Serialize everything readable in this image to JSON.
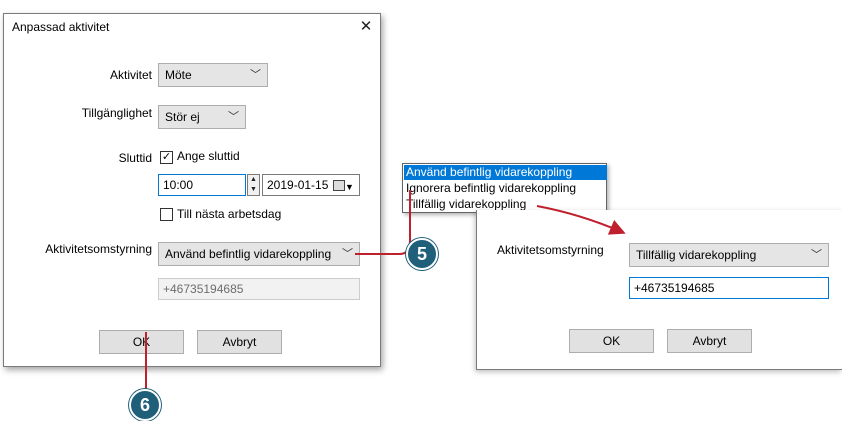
{
  "dialog": {
    "title": "Anpassad aktivitet",
    "close_glyph": "✕",
    "aktivitet": {
      "label": "Aktivitet",
      "value": "Möte"
    },
    "tillganglighet": {
      "label": "Tillgänglighet",
      "value": "Stör ej"
    },
    "sluttid": {
      "label": "Sluttid",
      "ange_label": "Ange sluttid",
      "ange_checked": true,
      "time": "10:00",
      "date": "2019-01-15"
    },
    "nasta_arbetsdag": {
      "label": "Till nästa arbetsdag",
      "checked": false
    },
    "omstyrning": {
      "label": "Aktivitetsomstyrning",
      "value": "Använd befintlig vidarekoppling"
    },
    "phone": "+46735194685",
    "ok_label": "OK",
    "cancel_label": "Avbryt"
  },
  "dropdown": {
    "options": [
      "Använd befintlig vidarekoppling",
      "Ignorera befintlig vidarekoppling",
      "Tillfällig vidarekoppling"
    ],
    "selected_index": 0
  },
  "dialog2": {
    "omstyrning": {
      "label": "Aktivitetsomstyrning",
      "value": "Tillfällig vidarekoppling"
    },
    "phone": "+46735194685",
    "ok_label": "OK",
    "cancel_label": "Avbryt"
  },
  "callouts": {
    "five": "5",
    "six": "6"
  },
  "colors": {
    "accent": "#0078d7",
    "callout": "#1f5f7a",
    "arrow": "#c0202e"
  },
  "icons": {
    "chevron": "chevron-down-icon",
    "calendar": "calendar-icon",
    "check": "checkmark-icon"
  }
}
